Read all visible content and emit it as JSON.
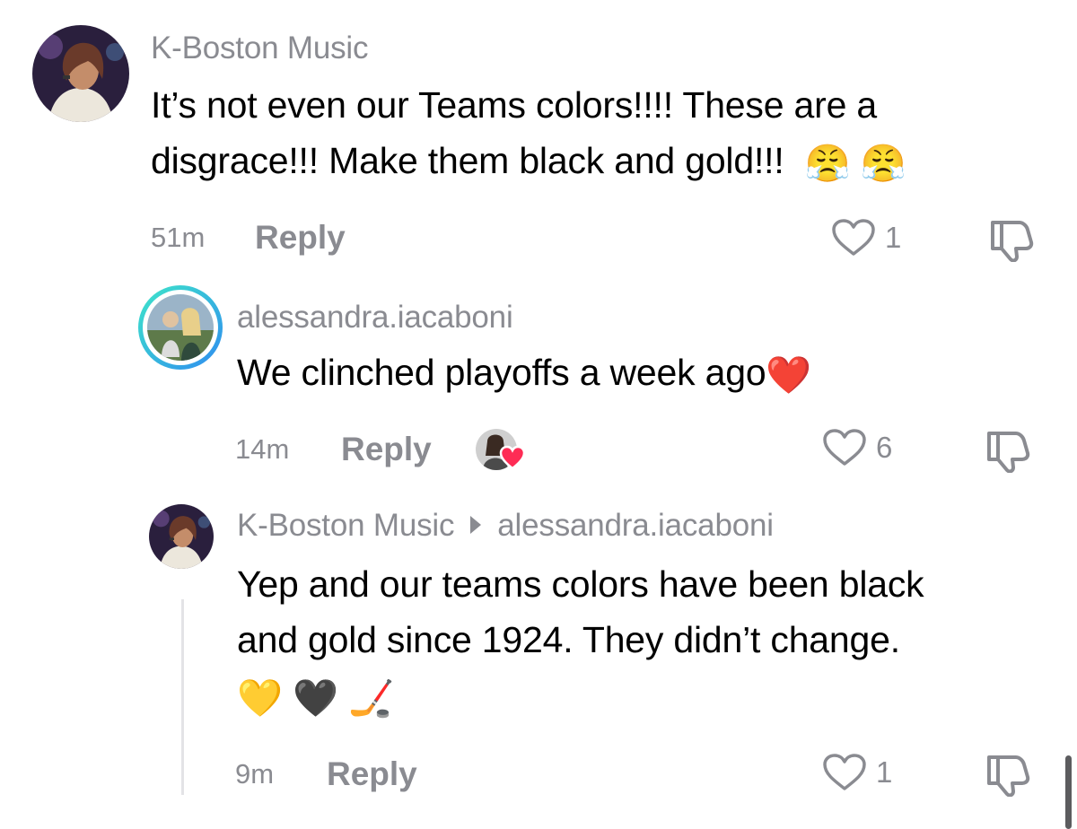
{
  "comments": [
    {
      "username": "K-Boston Music",
      "text_line1": "It’s not even our Teams colors!!!! These are a",
      "text_line2": "disgrace!!! Make them black and gold!!!",
      "emojis": [
        "😤",
        "😤"
      ],
      "time": "51m",
      "reply_label": "Reply",
      "likes": "1"
    },
    {
      "username": "alessandra.iacaboni",
      "text": "We clinched playoffs a week ago",
      "emoji": "❤️",
      "time": "14m",
      "reply_label": "Reply",
      "likes": "6"
    },
    {
      "username": "K-Boston Music",
      "reply_to": "alessandra.iacaboni",
      "text_line1": "Yep and our teams colors have been black",
      "text_line2": "and gold since 1924. They didn’t change.",
      "emojis": [
        "💛",
        "🖤",
        "🏒"
      ],
      "time": "9m",
      "reply_label": "Reply",
      "likes": "1"
    }
  ],
  "colors": {
    "meta_gray": "#8a8b91",
    "text": "#000000",
    "story_ring_start": "#3ee6c9",
    "story_ring_end": "#2f8cf0",
    "heart_red": "#fe2c55"
  },
  "icons": {
    "like": "heart-outline-icon",
    "dislike": "thumbs-down-icon",
    "creator_liked": "heart-badge-icon"
  }
}
